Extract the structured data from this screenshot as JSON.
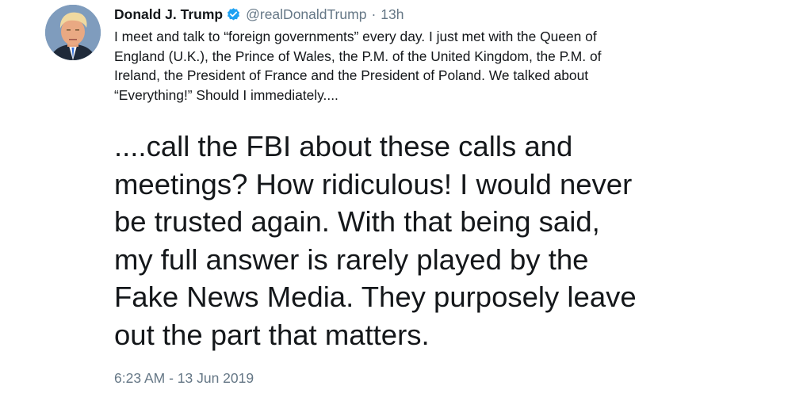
{
  "tweet": {
    "author_name": "Donald J. Trump",
    "handle": "@realDonaldTrump",
    "separator": "·",
    "age": "13h",
    "verified_icon": "verified-badge-icon",
    "quoted_text": "I meet and talk to “foreign governments” every day. I just met with the Queen of\nEngland (U.K.), the Prince of Wales, the P.M. of the United Kingdom, the P.M. of\nIreland, the President of France and the President of Poland. We talked about\n“Everything!” Should I immediately....",
    "main_text": "....call the FBI about these calls and\nmeetings? How ridiculous! I would never\nbe trusted again. With that being said,\nmy full answer is rarely played by the\nFake News Media. They purposely leave\nout the part that matters.",
    "timestamp": "6:23 AM - 13 Jun 2019"
  },
  "colors": {
    "verified_blue": "#1da1f2",
    "secondary_text": "#657786",
    "primary_text": "#14171a"
  }
}
